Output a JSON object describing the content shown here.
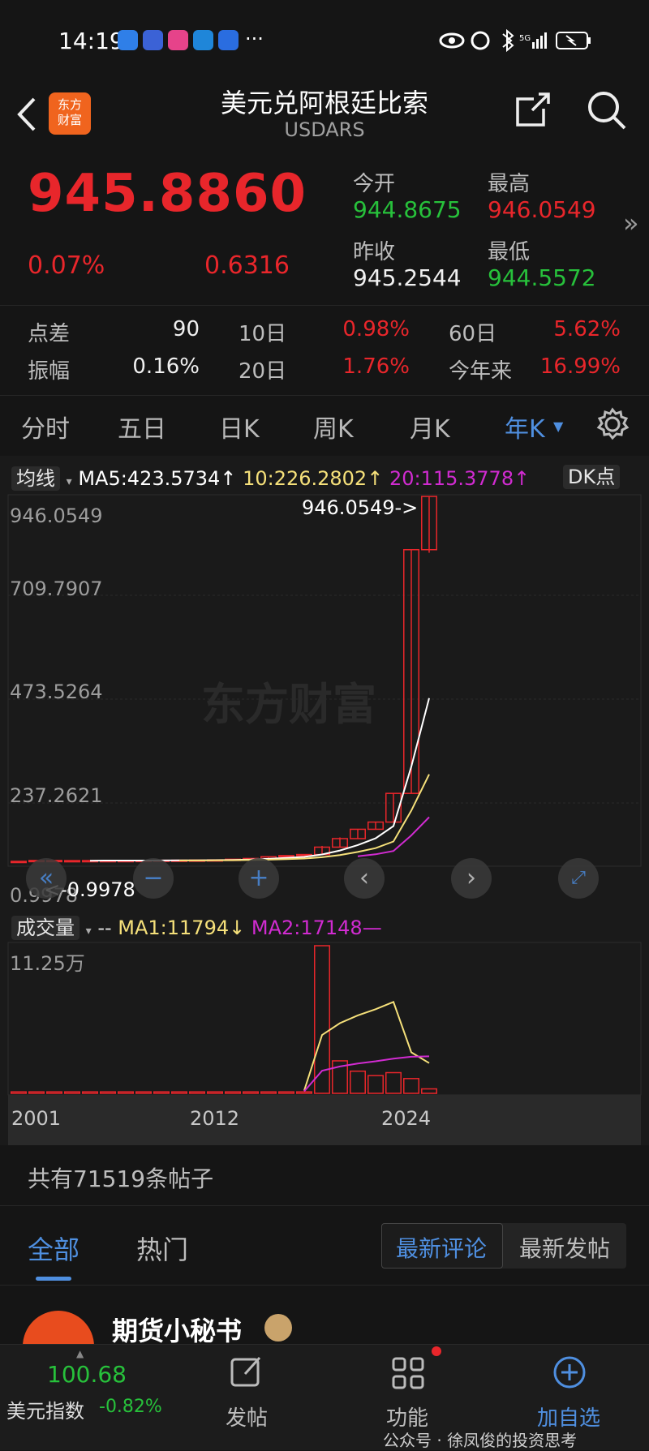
{
  "status_bar": {
    "time": "14:19",
    "more": "···"
  },
  "header": {
    "title": "美元兑阿根廷比索",
    "subtitle": "USDARS",
    "logo_text": "东方财富"
  },
  "quote": {
    "price": "945.8860",
    "change_pct": "0.07%",
    "change": "0.6316",
    "open_label": "今开",
    "open": "944.8675",
    "high_label": "最高",
    "high": "946.0549",
    "prev_close_label": "昨收",
    "prev_close": "945.2544",
    "low_label": "最低",
    "low": "944.5572",
    "expand": "»"
  },
  "stats": {
    "spread_label": "点差",
    "spread": "90",
    "amp_label": "振幅",
    "amp": "0.16%",
    "d10_label": "10日",
    "d10": "0.98%",
    "d20_label": "20日",
    "d20": "1.76%",
    "d60_label": "60日",
    "d60": "5.62%",
    "ytd_label": "今年来",
    "ytd": "16.99%"
  },
  "tabs": [
    "分时",
    "五日",
    "日K",
    "周K",
    "月K",
    "年K"
  ],
  "active_tab": "年K",
  "chart": {
    "ma_label": "均线",
    "ma5": "MA5:423.5734↑",
    "ma10": "10:226.2802↑",
    "ma20": "20:115.3778↑",
    "dk_label": "DK点",
    "price_ticks": [
      "946.0549",
      "709.7907",
      "473.5264",
      "237.2621",
      "0.9978"
    ],
    "high_marker": "946.0549->",
    "low_marker": "<-0.9978",
    "watermark": "东方财富",
    "vol_label": "成交量",
    "vol_dash": "--",
    "ma1": "MA1:11794↓",
    "ma2": "MA2:17148—",
    "vol_tick": "11.25万",
    "years": [
      "2001",
      "2012",
      "2024"
    ]
  },
  "chart_data": {
    "type": "candlestick",
    "note_period": "yearly",
    "years": [
      2001,
      2002,
      2003,
      2004,
      2005,
      2006,
      2007,
      2008,
      2009,
      2010,
      2011,
      2012,
      2013,
      2014,
      2015,
      2016,
      2017,
      2018,
      2019,
      2020,
      2021,
      2022,
      2023,
      2024
    ],
    "open": [
      1.0,
      1.0,
      3.3,
      2.9,
      2.95,
      3.03,
      3.06,
      3.15,
      3.45,
      3.8,
      3.97,
      4.3,
      4.9,
      6.5,
      8.5,
      13,
      15.9,
      18.7,
      37.8,
      59.9,
      84.1,
      102.7,
      177,
      808
    ],
    "close": [
      1.0,
      3.3,
      2.9,
      2.95,
      3.03,
      3.06,
      3.15,
      3.45,
      3.8,
      3.97,
      4.3,
      4.9,
      6.5,
      8.5,
      13,
      15.9,
      18.7,
      37.8,
      59.9,
      84.1,
      102.7,
      177,
      808,
      945.9
    ],
    "high": [
      1.0,
      3.9,
      3.4,
      3.0,
      3.1,
      3.1,
      3.2,
      3.5,
      3.85,
      4.0,
      4.35,
      4.95,
      6.6,
      8.6,
      13.8,
      16,
      19.5,
      41,
      63,
      84.2,
      102.8,
      177.2,
      808.5,
      946.0549
    ],
    "low": [
      0.9978,
      1.0,
      2.8,
      2.8,
      2.85,
      3.0,
      3.05,
      3.1,
      3.4,
      3.7,
      3.95,
      4.25,
      4.85,
      6.4,
      8.4,
      13,
      15.8,
      17,
      37,
      59.8,
      84,
      102.5,
      176.9,
      800
    ],
    "ma5_last": 423.5734,
    "ma10_last": 226.2802,
    "ma20_last": 115.3778,
    "ylim": [
      0.9978,
      946.0549
    ],
    "volume_ma1_last": 11794,
    "volume_ma2_last": 17148,
    "volume_max_label": "11.25万"
  },
  "posts": {
    "count_text": "共有71519条帖子",
    "tab_all": "全部",
    "tab_hot": "热门",
    "sort_latest_comment": "最新评论",
    "sort_latest_post": "最新发帖",
    "first_author": "期货小秘书"
  },
  "bottom_nav": {
    "index_value": "100.68",
    "index_name": "美元指数",
    "index_change": "-0.82%",
    "post": "发帖",
    "functions": "功能",
    "add_watch": "加自选",
    "watermark_text": "公众号 · 徐凤俊的投资思考"
  },
  "colors": {
    "up": "#e8262b",
    "down": "#27c13b",
    "accent": "#4f8fe0",
    "ma5": "#ffffff",
    "ma10": "#f5e07a",
    "ma20": "#d12bd1"
  }
}
